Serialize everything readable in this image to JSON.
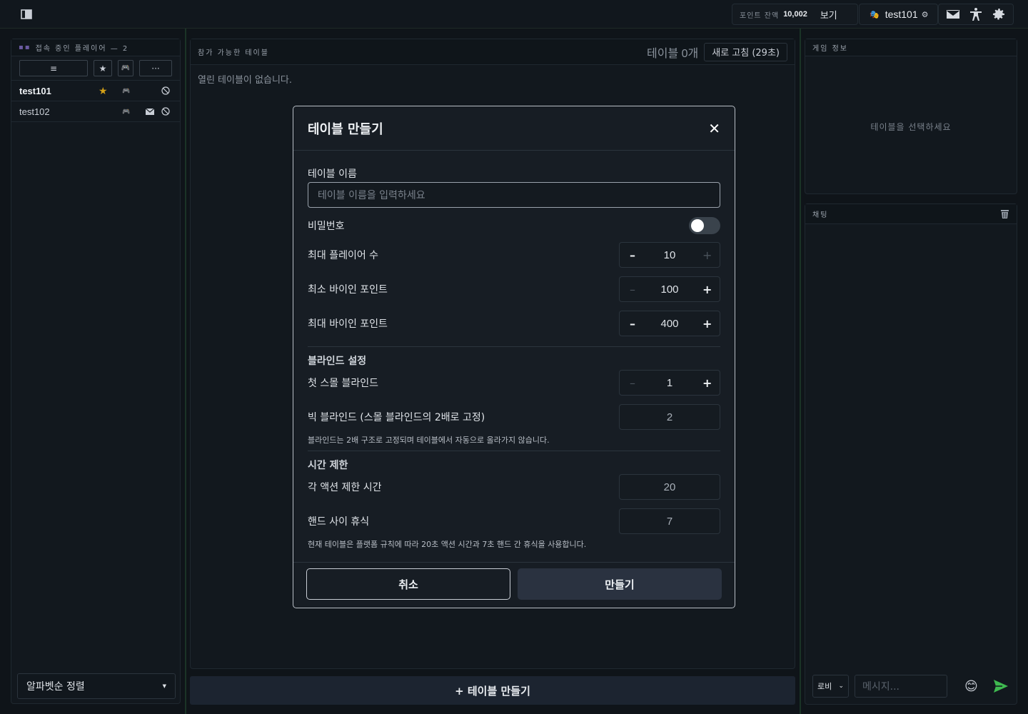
{
  "topbar": {
    "points_label": "포인트 잔액",
    "points_value": "10,002",
    "view_label": "보기",
    "username": "test101",
    "mask_icon": "theater-mask-icon",
    "icons": [
      "mail-icon",
      "accessibility-icon",
      "gear-icon"
    ]
  },
  "left": {
    "title": "접속 중인 플레이어 — 2",
    "filters": [
      "≡",
      "★",
      "🎮",
      "···"
    ],
    "players": [
      {
        "name": "test101",
        "star": "★",
        "bold": true
      },
      {
        "name": "test102",
        "star": "",
        "bold": false
      }
    ],
    "sort_label": "알파벳순 정렬"
  },
  "center": {
    "title": "참가 가능한 테이블",
    "count": "테이블 0개",
    "refresh": "새로 고침 (29초)",
    "empty": "열린 테이블이 없습니다.",
    "create_button": "+ 테이블 만들기"
  },
  "right": {
    "gameinfo_title": "게임 정보",
    "gameinfo_empty": "테이블을 선택하세요",
    "chat_title": "채팅",
    "chat_channel": "로비",
    "chat_placeholder": "메시지..."
  },
  "modal": {
    "title": "테이블 만들기",
    "close": "✕",
    "name_label": "테이블 이름",
    "name_placeholder": "테이블 이름을 입력하세요",
    "password_label": "비밀번호",
    "password_on": false,
    "max_players_label": "최대 플레이어 수",
    "max_players": "10",
    "min_buyin_label": "최소 바이인 포인트",
    "min_buyin": "100",
    "max_buyin_label": "최대 바이인 포인트",
    "max_buyin": "400",
    "blind_section": "블라인드 설정",
    "small_blind_label": "첫 스몰 블라인드",
    "small_blind": "1",
    "big_blind_label": "빅 블라인드 (스몰 블라인드의 2배로 고정)",
    "big_blind": "2",
    "blind_note": "블라인드는 2배 구조로 고정되며 테이블에서 자동으로 올라가지 않습니다.",
    "time_section": "시간 제한",
    "action_time_label": "각 액션 제한 시간",
    "action_time": "20",
    "hand_break_label": "핸드 사이 휴식",
    "hand_break": "7",
    "time_note": "현재 테이블은 플랫폼 규칙에 따라 20초 액션 시간과 7초 핸드 간 휴식을 사용합니다.",
    "cancel": "취소",
    "create": "만들기"
  },
  "colors": {
    "background": "#0f1419",
    "panel": "#12181e",
    "accent_star": "#d4a017",
    "send": "#3fb950"
  }
}
